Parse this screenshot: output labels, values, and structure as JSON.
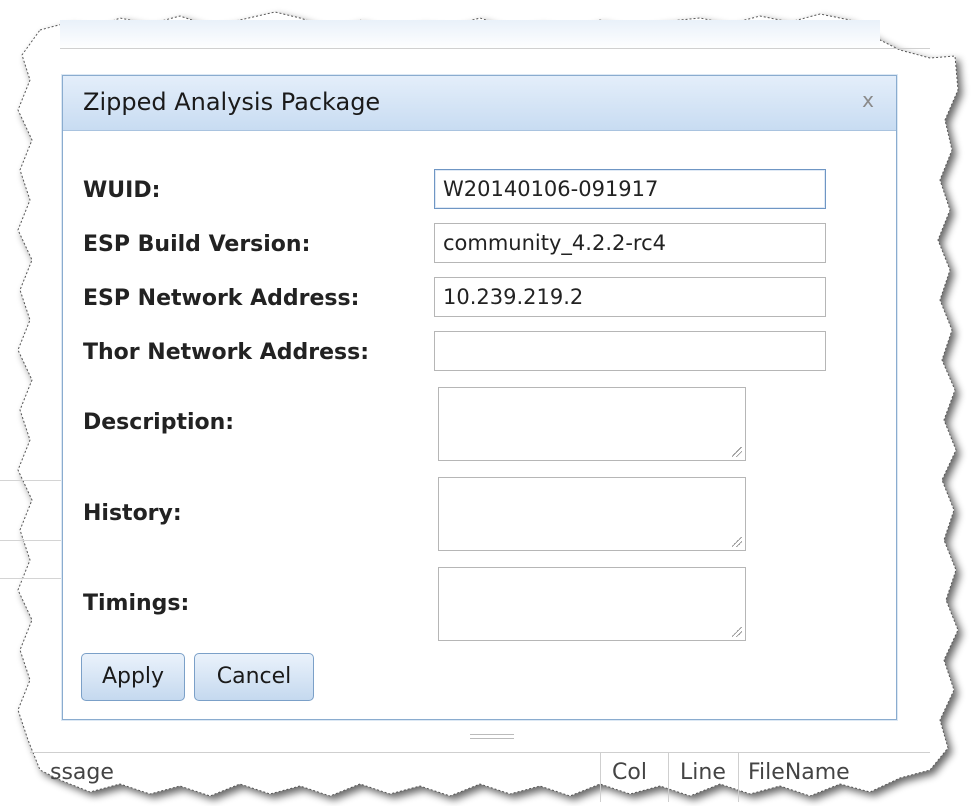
{
  "dialog": {
    "title": "Zipped Analysis Package",
    "close_glyph": "x"
  },
  "form": {
    "wuid_label": "WUID:",
    "wuid_value": "W20140106-091917",
    "build_label": "ESP Build Version:",
    "build_value": "community_4.2.2-rc4",
    "esp_addr_label": "ESP Network Address:",
    "esp_addr_value": "10.239.219.2",
    "thor_addr_label": "Thor Network Address:",
    "thor_addr_value": "",
    "description_label": "Description:",
    "history_label": "History:",
    "timings_label": "Timings:"
  },
  "buttons": {
    "apply": "Apply",
    "cancel": "Cancel"
  },
  "background": {
    "columns": {
      "message": "ssage",
      "col": "Col",
      "line": "Line",
      "filename": "FileName"
    }
  },
  "colors": {
    "titlebar_top": "#e4eefa",
    "titlebar_bottom": "#c8dcf2",
    "dialog_border": "#8aaccf",
    "button_border": "#7ba0c8"
  },
  "icons": {
    "close": "close-icon",
    "resize": "resize-grip-icon"
  }
}
